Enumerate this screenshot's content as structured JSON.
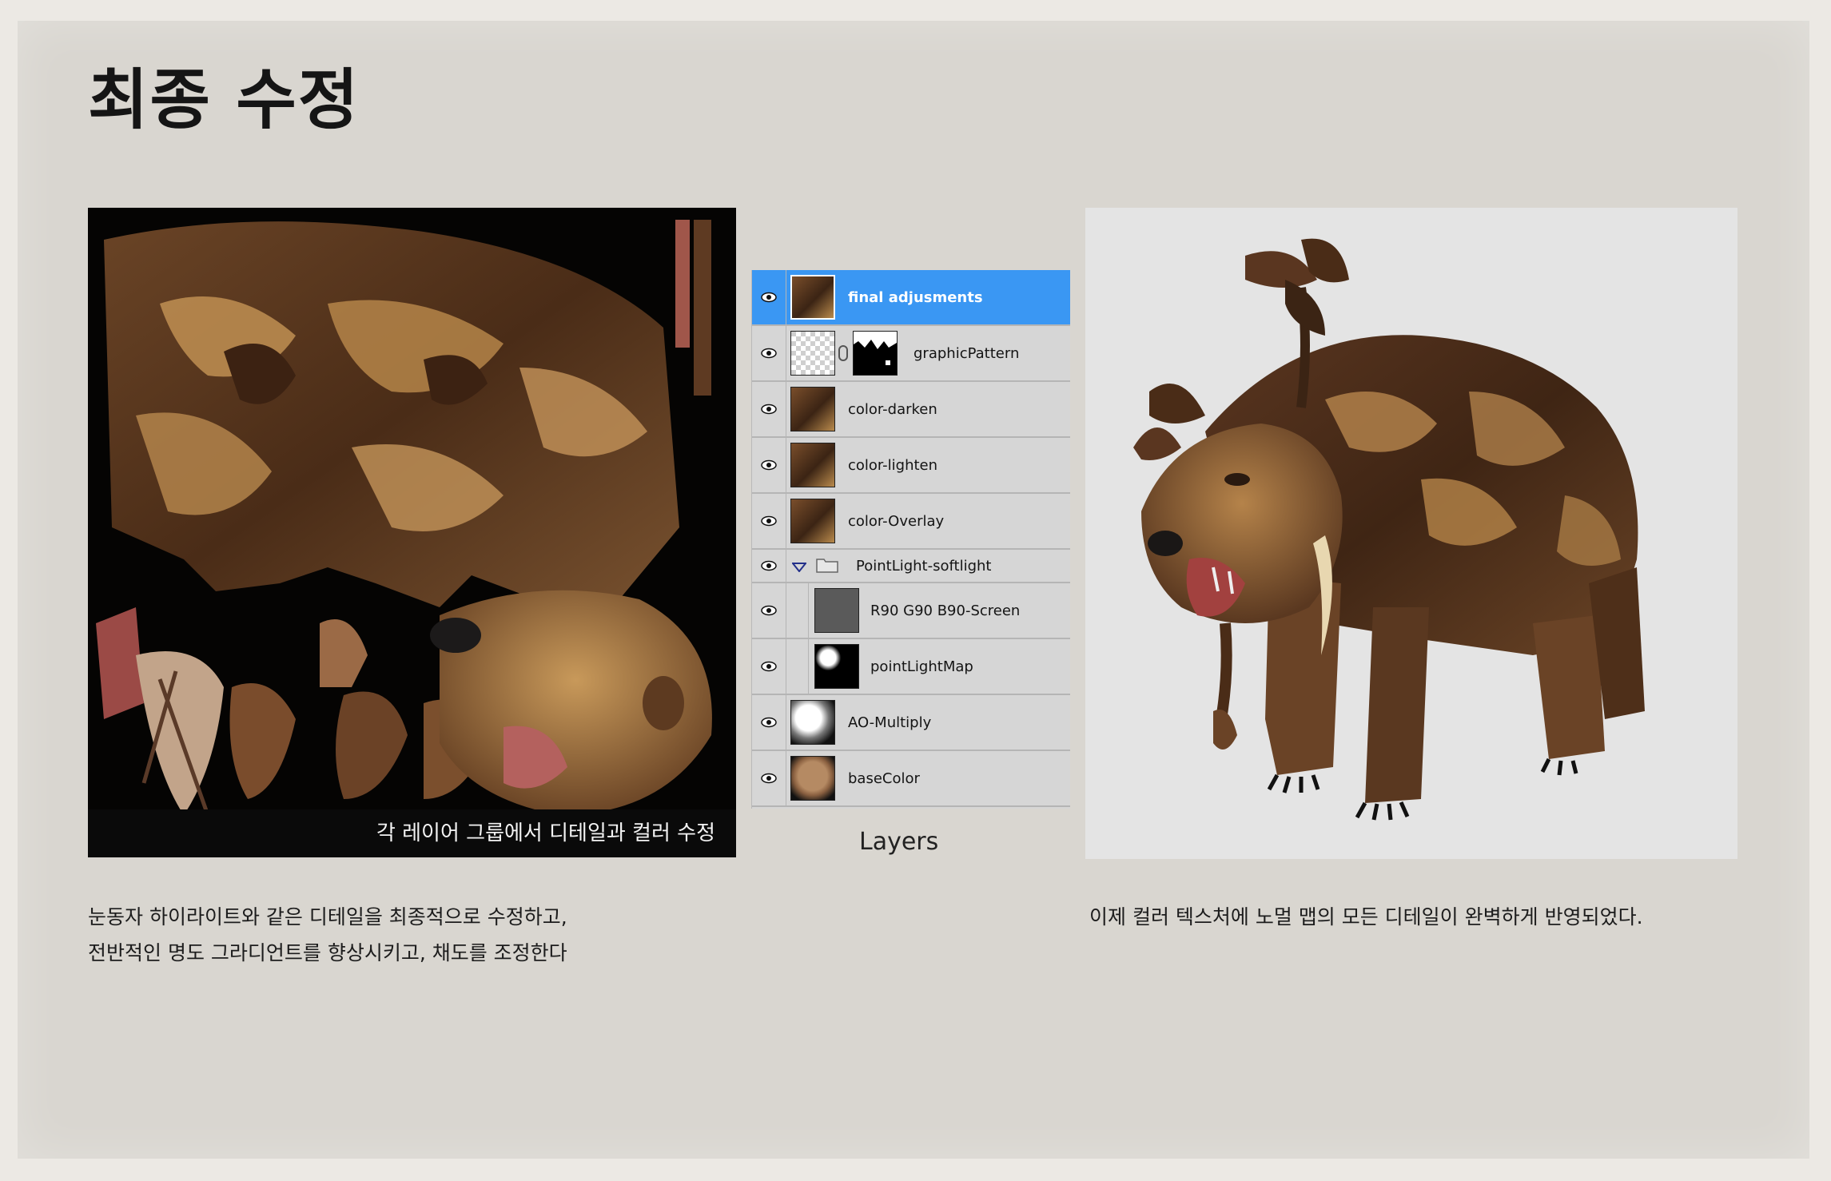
{
  "title": "최종 수정",
  "texture_panel": {
    "caption": "각 레이어 그룹에서 디테일과 컬러 수정"
  },
  "layers_panel": {
    "label": "Layers",
    "layers": [
      {
        "name": "final adjusments",
        "selected": true,
        "thumb": "fur-texture"
      },
      {
        "name": "graphicPattern",
        "selected": false,
        "thumb": "transparent-with-mask"
      },
      {
        "name": "color-darken",
        "selected": false,
        "thumb": "fur-texture"
      },
      {
        "name": "color-lighten",
        "selected": false,
        "thumb": "fur-texture"
      },
      {
        "name": "color-Overlay",
        "selected": false,
        "thumb": "fur-texture"
      },
      {
        "name": "PointLight-softlight",
        "selected": false,
        "thumb": "folder",
        "group": true
      },
      {
        "name": "R90 G90 B90-Screen",
        "selected": false,
        "thumb": "gray-fill"
      },
      {
        "name": "pointLightMap",
        "selected": false,
        "thumb": "bw-map"
      },
      {
        "name": "AO-Multiply",
        "selected": false,
        "thumb": "ao-map"
      },
      {
        "name": "baseColor",
        "selected": false,
        "thumb": "base-color"
      }
    ]
  },
  "left_description": {
    "line1": "눈동자 하이라이트와 같은 디테일을 최종적으로 수정하고,",
    "line2": "전반적인 명도 그라디언트를 향상시키고, 채도를 조정한다"
  },
  "right_description": {
    "line1": "이제 컬러 텍스처에 노멀 맵의 모든 디테일이 완벽하게 반영되었다."
  },
  "colors": {
    "selection": "#3a97f3",
    "fur_dark": "#3b2414",
    "fur_light": "#b98a4c"
  }
}
